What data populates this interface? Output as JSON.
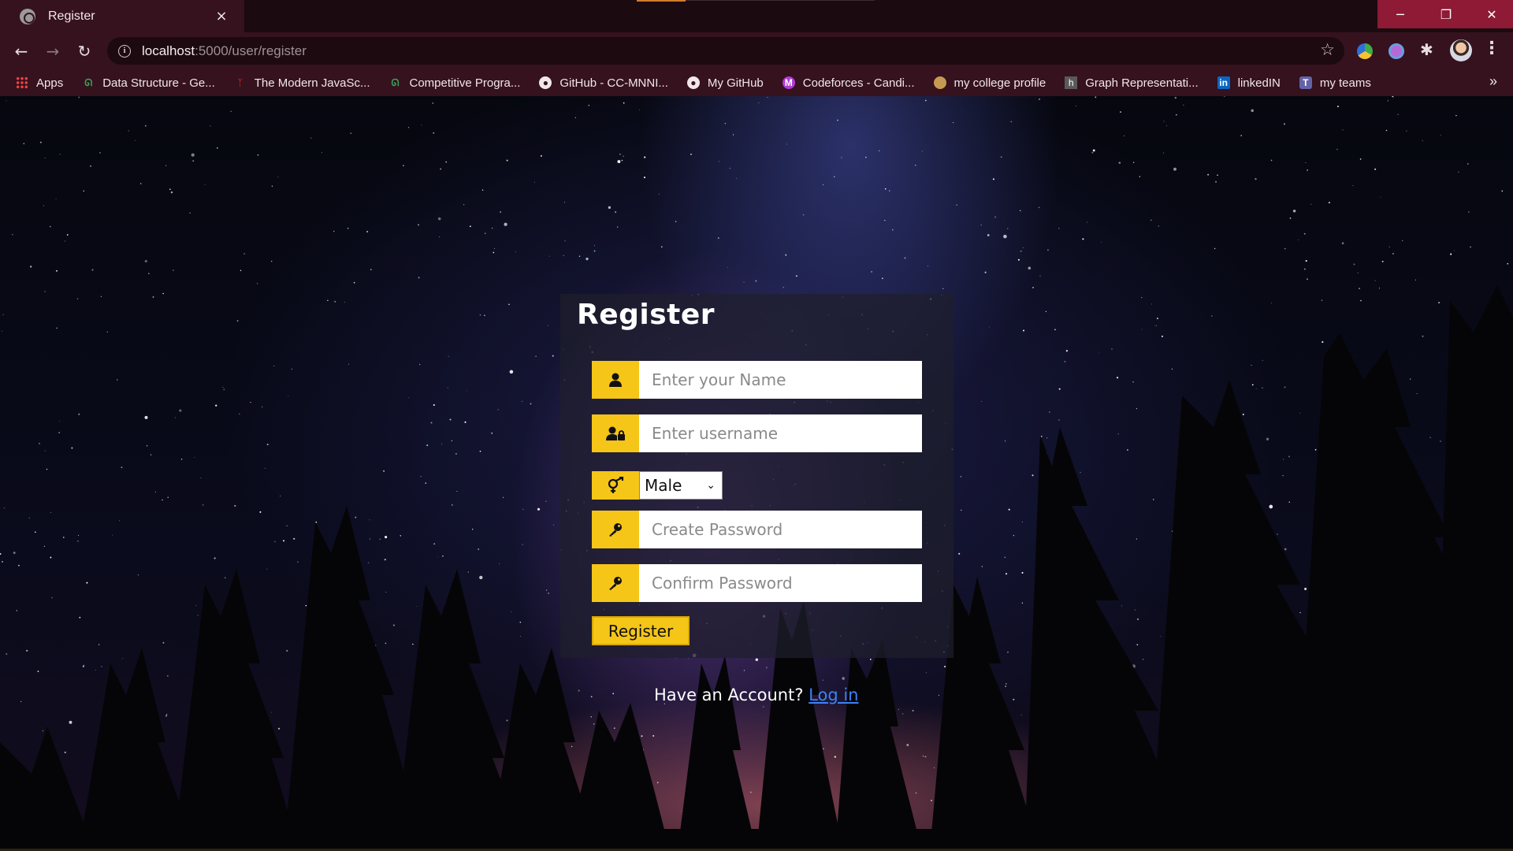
{
  "browser": {
    "tab_title": "Register",
    "tab_close": "×",
    "url_host": "localhost",
    "url_rest": ":5000/user/register",
    "window_buttons": {
      "minimize": "─",
      "maximize": "❐",
      "close": "✕"
    },
    "nav": {
      "back": "←",
      "forward": "→",
      "reload": "↻",
      "menu": "⋮",
      "star": "☆",
      "more": "»"
    }
  },
  "bookmarks": [
    {
      "label": "Apps",
      "icon": "apps-grid-icon"
    },
    {
      "label": "Data Structure - Ge...",
      "icon": "geeksforgeeks-icon"
    },
    {
      "label": "The Modern JavaSc...",
      "icon": "javascript-info-icon"
    },
    {
      "label": "Competitive Progra...",
      "icon": "geeksforgeeks-icon"
    },
    {
      "label": "GitHub - CC-MNNI...",
      "icon": "github-icon"
    },
    {
      "label": "My GitHub",
      "icon": "github-icon"
    },
    {
      "label": "Codeforces - Candi...",
      "icon": "codeforces-icon"
    },
    {
      "label": "my college profile",
      "icon": "college-icon"
    },
    {
      "label": "Graph Representati...",
      "icon": "hackerrank-icon"
    },
    {
      "label": "linkedIN",
      "icon": "linkedin-icon"
    },
    {
      "label": "my teams",
      "icon": "teams-icon"
    }
  ],
  "form": {
    "title": "Register",
    "name_placeholder": "Enter your Name",
    "username_placeholder": "Enter username",
    "gender_selected": "Male",
    "password_placeholder": "Create Password",
    "confirm_placeholder": "Confirm Password",
    "submit_label": "Register"
  },
  "footer": {
    "prompt": "Have an Account? ",
    "login_label": "Log in"
  },
  "colors": {
    "accent": "#f5c518",
    "link": "#3b82f6",
    "chrome": "#35121d"
  }
}
